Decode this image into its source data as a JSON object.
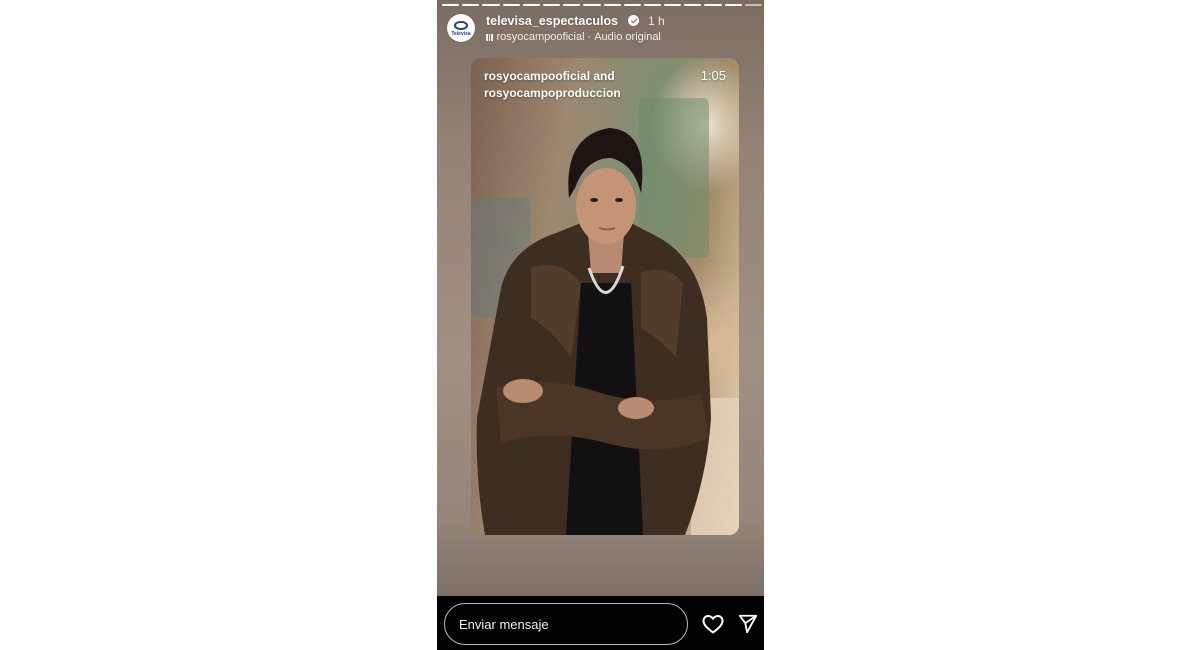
{
  "story": {
    "progress_segments_total": 16,
    "progress_segments_done": 15,
    "account": {
      "username": "televisa_espectaculos",
      "time_ago": "1 h",
      "avatar_text": "Televisa"
    },
    "audio": {
      "artist": "rosyocampooficial",
      "separator": "·",
      "label": "Audio original"
    },
    "media": {
      "credit_line1": "rosyocampooficial and",
      "credit_line2": "rosyocampoproduccion",
      "duration": "1:05"
    }
  },
  "footer": {
    "message_placeholder": "Enviar mensaje",
    "icons": [
      "heart-icon",
      "send-icon"
    ]
  },
  "colors": {
    "background": "#ffffff",
    "footer": "#000000",
    "text": "#ffffff",
    "brand_blue": "#1b3f91"
  }
}
